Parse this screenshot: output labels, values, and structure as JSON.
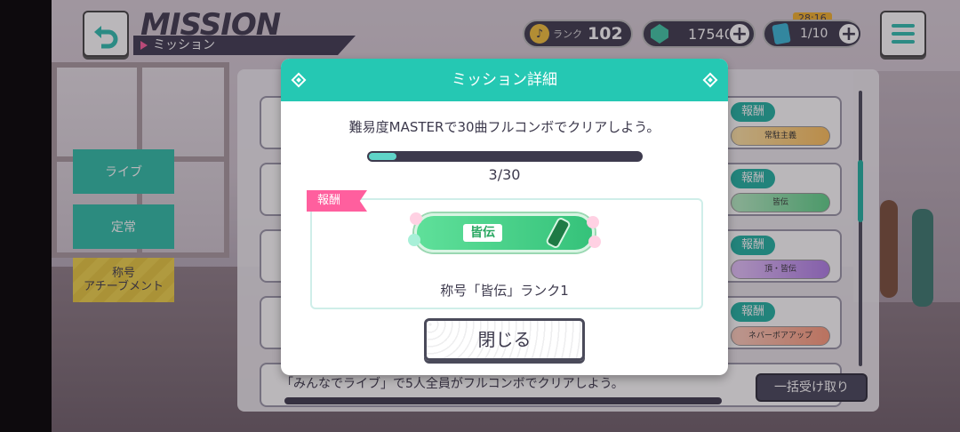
{
  "header": {
    "title": "MISSION",
    "subtitle": "ミッション"
  },
  "status": {
    "rank_label": "ランク",
    "rank_value": "102",
    "gems": "17540",
    "items": "1/10",
    "timer": "28:16"
  },
  "tabs": [
    {
      "label": "ライブ"
    },
    {
      "label": "定常"
    },
    {
      "label": "称号\nアチーブメント"
    }
  ],
  "list": {
    "reward_label": "報酬",
    "chips": [
      "常駐主義",
      "皆伝",
      "頂・皆伝",
      "ネバーボアアップ"
    ],
    "partial_mission_text": "「みんなでライブ」で5人全員がフルコンボでクリアしよう。",
    "claim_all": "一括受け取り"
  },
  "dialog": {
    "title": "ミッション詳細",
    "description": "難易度MASTERで30曲フルコンボでクリアしよう。",
    "progress_current": 3,
    "progress_total": 30,
    "progress_text": "3/30",
    "reward_tag": "報酬",
    "reward_plate_name": "皆伝",
    "reward_name": "称号「皆伝」ランク1",
    "close_label": "閉じる"
  },
  "colors": {
    "accent": "#25c8b3",
    "reward_tag": "#ff5f9e",
    "dark": "#3d3a4d"
  }
}
